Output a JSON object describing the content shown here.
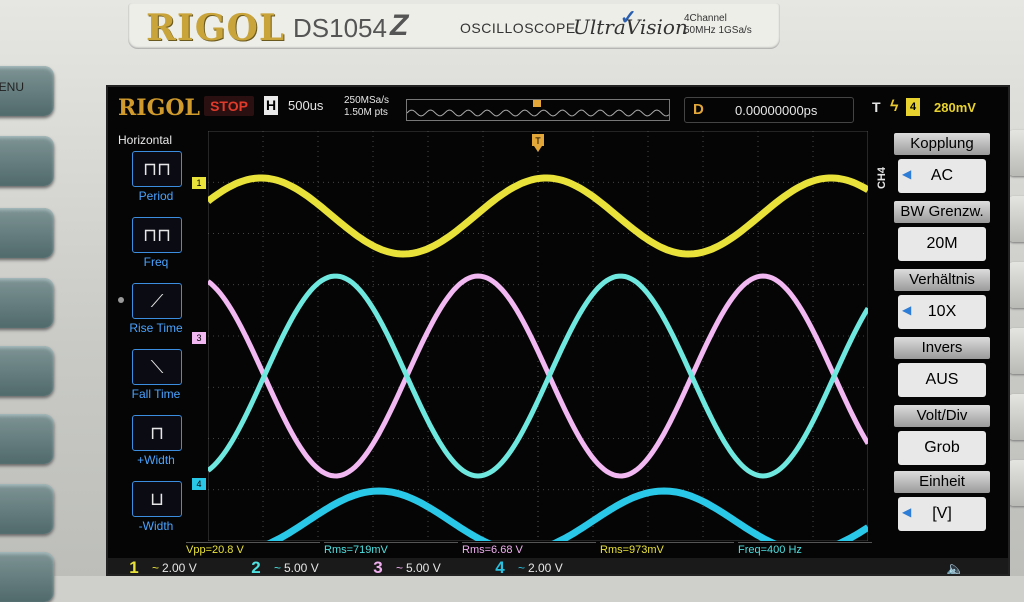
{
  "brand": {
    "logo": "RIGOL",
    "model": "DS1054",
    "model_z": "Z",
    "oscilloscope": "OSCILLOSCOPE",
    "ultravision": "UltraVision",
    "spec_line1": "4Channel",
    "spec_line2": "50MHz 1GSa/s"
  },
  "hardware": {
    "menu_button": "ENU"
  },
  "status": {
    "logo": "RIGOL",
    "run_state": "STOP",
    "h_label": "H",
    "timebase": "500us",
    "sample_rate": "250MSa/s",
    "memory_depth": "1.50M pts"
  },
  "delay": {
    "label": "D",
    "value": "0.00000000ps"
  },
  "trigger": {
    "label": "T",
    "channel": "4",
    "level": "280mV",
    "colors": {
      "trigger": "#e8d22e"
    }
  },
  "horizontal_menu": {
    "title": "Horizontal",
    "items": [
      {
        "label": "Period",
        "icon": "period-icon"
      },
      {
        "label": "Freq",
        "icon": "frequency-icon"
      },
      {
        "label": "Rise Time",
        "icon": "rise-time-icon"
      },
      {
        "label": "Fall Time",
        "icon": "fall-time-icon"
      },
      {
        "label": "+Width",
        "icon": "positive-width-icon"
      },
      {
        "label": "-Width",
        "icon": "negative-width-icon"
      }
    ]
  },
  "channel_menu": {
    "channel_label": "CH4",
    "items": [
      {
        "title": "Kopplung",
        "value": "AC"
      },
      {
        "title": "BW Grenzw.",
        "value": "20M"
      },
      {
        "title": "Verhältnis",
        "value": "10X"
      },
      {
        "title": "Invers",
        "value": "AUS"
      },
      {
        "title": "Volt/Div",
        "value": "Grob"
      },
      {
        "title": "Einheit",
        "value": "[V]"
      }
    ]
  },
  "measurements": [
    {
      "text": "Vpp=20.8 V",
      "color": "#e8e23a"
    },
    {
      "text": "Rms=719mV",
      "color": "#4fe0e0"
    },
    {
      "text": "Rms=6.68 V",
      "color": "#f0b0f0"
    },
    {
      "text": "Rms=973mV",
      "color": "#e8e23a"
    },
    {
      "text": "Freq=400 Hz",
      "color": "#4fe0e0"
    }
  ],
  "channels": [
    {
      "num": "1",
      "scale": "2.00 V",
      "color": "#e8e23a"
    },
    {
      "num": "2",
      "scale": "5.00 V",
      "color": "#4fe0e0"
    },
    {
      "num": "3",
      "scale": "5.00 V",
      "color": "#f0b0f0"
    },
    {
      "num": "4",
      "scale": "2.00 V",
      "color": "#2ac0e0"
    }
  ],
  "channel_markers": [
    "1",
    "3",
    "4"
  ],
  "coupling_symbol": "~",
  "colors": {
    "ch1": "#e8e23a",
    "ch2": "#6fe8e0",
    "ch3": "#f2b8f2",
    "ch4": "#2ac8e8",
    "grid": "#5a5a5a"
  }
}
